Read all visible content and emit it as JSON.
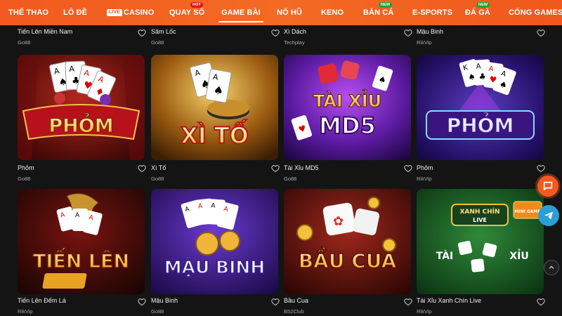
{
  "nav": {
    "items": [
      {
        "label": "THỂ THAO",
        "live": false,
        "tag": ""
      },
      {
        "label": "LÔ ĐỀ",
        "live": false,
        "tag": ""
      },
      {
        "label": "CASINO",
        "live": true,
        "live_label": "LIVE",
        "tag": ""
      },
      {
        "label": "QUAY SỐ",
        "live": false,
        "tag": "HOT"
      },
      {
        "label": "GAME BÀI",
        "live": false,
        "tag": "",
        "active": true
      },
      {
        "label": "NỔ HŨ",
        "live": false,
        "tag": ""
      },
      {
        "label": "KENO",
        "live": false,
        "tag": ""
      },
      {
        "label": "BẮN CÁ",
        "live": false,
        "tag": "NEW"
      },
      {
        "label": "E-SPORTS",
        "live": false,
        "tag": ""
      },
      {
        "label": "ĐÁ GÀ",
        "live": false,
        "tag": "NEW"
      },
      {
        "label": "CỔNG GAMES",
        "live": false,
        "tag": ""
      }
    ]
  },
  "top_row": [
    {
      "title": "Tiến Lên Miền Nam",
      "provider": "Go88"
    },
    {
      "title": "Sâm Lốc",
      "provider": "Go88"
    },
    {
      "title": "Xì Dách",
      "provider": "Techplay"
    },
    {
      "title": "Mậu Binh",
      "provider": "RikVip"
    }
  ],
  "games": [
    {
      "title": "Phỏm",
      "provider": "Go88",
      "art_text": "PHỎM"
    },
    {
      "title": "Xì Tố",
      "provider": "Go88",
      "art_text": "XÌ TỐ"
    },
    {
      "title": "Tài Xỉu MD5",
      "provider": "Go88",
      "art_text": "TÀI XỈU",
      "art_text2": "MD5"
    },
    {
      "title": "Phỏm",
      "provider": "RikVip",
      "art_text": "PHỎM"
    },
    {
      "title": "Tiến Lên Đếm Lá",
      "provider": "RikVip",
      "art_text": "TIẾN LÊN"
    },
    {
      "title": "Mậu Binh",
      "provider": "Go88",
      "art_text": "MẬU BINH"
    },
    {
      "title": "Bầu Cua",
      "provider": "B52Club",
      "art_text": "BẦU CUA"
    },
    {
      "title": "Tài Xỉu Xanh Chín Live",
      "provider": "RikVip",
      "art_text": "TÀI",
      "art_text2": "XỈU",
      "art_badge": "XANH CHÍN",
      "art_badge2": "LIVE",
      "art_badge3": "MINI GAME"
    }
  ],
  "colors": {
    "accent": "#f25a1f",
    "background": "#141414",
    "telegram": "#2a9fd6"
  }
}
